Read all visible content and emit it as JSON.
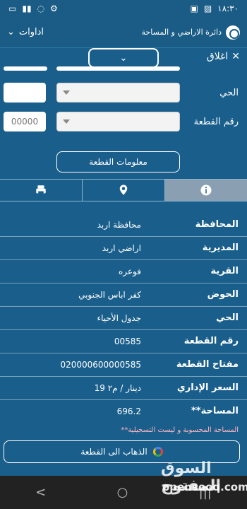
{
  "status": {
    "time": "١٨:٣٠"
  },
  "header": {
    "tools": "اداوات",
    "brand": "دائرة الاراضي و المساحة",
    "close": "اغلاق"
  },
  "form": {
    "district_label": "الحي",
    "parcel_label": "رقم القطعة",
    "parcel_placeholder": "00000",
    "info_button": "معلومات القطعة"
  },
  "tabs": [
    {
      "icon": "print-icon"
    },
    {
      "icon": "location-pin-icon"
    },
    {
      "icon": "info-icon"
    }
  ],
  "details": [
    {
      "label": "المحافظة",
      "value": "محافظة اربد"
    },
    {
      "label": "المديرية",
      "value": "اراضي اربد"
    },
    {
      "label": "القرية",
      "value": "فوعره"
    },
    {
      "label": "الحوض",
      "value": "كفر اباس الجنوبي"
    },
    {
      "label": "الحي",
      "value": "جدول الأحياء"
    },
    {
      "label": "رقم القطعة",
      "value": "00585"
    },
    {
      "label": "مفتاح القطعة",
      "value": "020000600000585"
    },
    {
      "label": "السعر الإداري",
      "value": "19 دينار / م٢"
    },
    {
      "label": "**المساحة",
      "value": "696.2"
    }
  ],
  "note": "**المساحة المحسوبة و ليست التسجيلية",
  "map_button": "الذهاب الى القطعة",
  "watermark": {
    "ar": "السوق المفتوح",
    "en": "opensooq.com"
  },
  "nav": [
    "|||",
    "○",
    "<"
  ]
}
